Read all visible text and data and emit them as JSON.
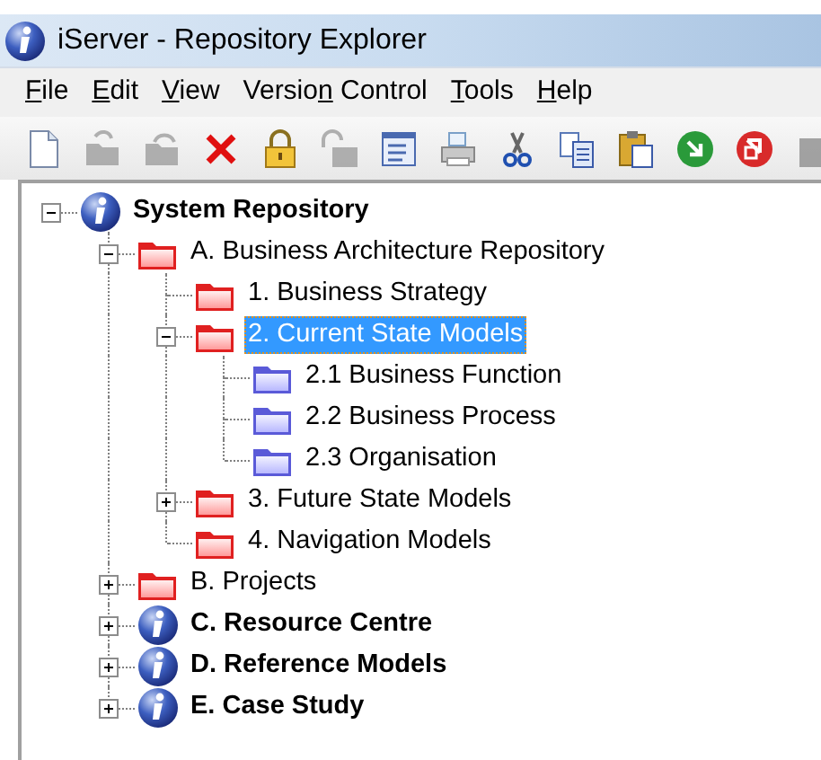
{
  "window": {
    "title": "iServer - Repository Explorer"
  },
  "menu": [
    {
      "key": "F",
      "after": "ile"
    },
    {
      "key": "E",
      "after": "dit"
    },
    {
      "key": "V",
      "after": "iew"
    },
    {
      "before": "Versio",
      "key": "n",
      "after": " Control"
    },
    {
      "key": "T",
      "after": "ools"
    },
    {
      "key": "H",
      "after": "elp"
    }
  ],
  "toolbar": [
    {
      "kind": "new",
      "disabled": false
    },
    {
      "kind": "open",
      "disabled": true
    },
    {
      "kind": "save",
      "disabled": true
    },
    {
      "kind": "delete",
      "disabled": false
    },
    {
      "kind": "lock",
      "disabled": false
    },
    {
      "kind": "unlock",
      "disabled": true
    },
    {
      "kind": "properties",
      "disabled": false
    },
    {
      "kind": "print",
      "disabled": false
    },
    {
      "kind": "cut",
      "disabled": false
    },
    {
      "kind": "copy",
      "disabled": false
    },
    {
      "kind": "paste",
      "disabled": false
    },
    {
      "kind": "check-in",
      "disabled": false
    },
    {
      "kind": "check-out",
      "disabled": false
    },
    {
      "kind": "more",
      "disabled": true
    }
  ],
  "tree": [
    {
      "label": "System Repository",
      "kind": "repository",
      "expanded": true,
      "selected": false,
      "children": [
        {
          "label": "A. Business Architecture Repository",
          "kind": "folder",
          "expanded": true,
          "selected": false,
          "children": [
            {
              "label": "1. Business Strategy",
              "kind": "folder",
              "selected": false
            },
            {
              "label": "2. Current State Models",
              "kind": "folder",
              "expanded": true,
              "selected": true,
              "children": [
                {
                  "label": "2.1 Business Function",
                  "kind": "model-folder",
                  "selected": false
                },
                {
                  "label": "2.2 Business Process",
                  "kind": "model-folder",
                  "selected": false
                },
                {
                  "label": "2.3 Organisation",
                  "kind": "model-folder",
                  "selected": false
                }
              ]
            },
            {
              "label": "3. Future State Models",
              "kind": "folder",
              "expanded": false,
              "selected": false
            },
            {
              "label": "4. Navigation Models",
              "kind": "folder",
              "selected": false
            }
          ]
        },
        {
          "label": "B. Projects",
          "kind": "folder",
          "expanded": false,
          "selected": false
        },
        {
          "label": "C. Resource Centre",
          "kind": "repository",
          "expanded": false,
          "selected": false
        },
        {
          "label": "D. Reference Models",
          "kind": "repository",
          "expanded": false,
          "selected": false
        },
        {
          "label": "E. Case Study",
          "kind": "repository",
          "expanded": false,
          "selected": false
        }
      ]
    }
  ]
}
